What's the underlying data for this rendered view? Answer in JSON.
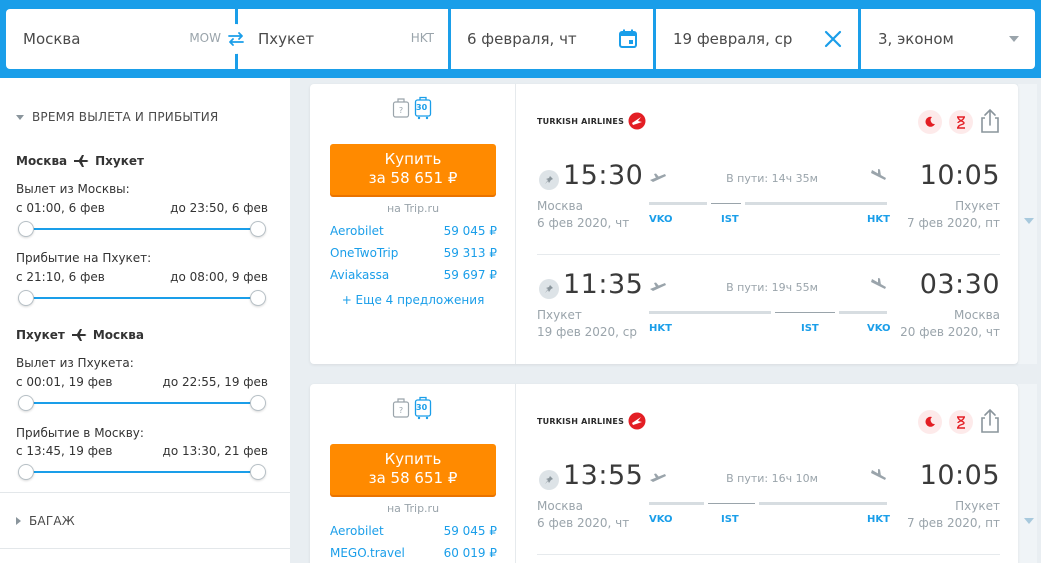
{
  "search": {
    "origin": "Москва",
    "origin_code": "MOW",
    "destination": "Пхукет",
    "destination_code": "HKT",
    "depart_date": "6 февраля, чт",
    "return_date": "19 февраля, ср",
    "passengers": "3, эконом"
  },
  "sidebar": {
    "time_filter_title": "ВРЕМЯ ВЫЛЕТА И ПРИБЫТИЯ",
    "outbound": {
      "route_from": "Москва",
      "route_to": "Пхукет",
      "departure_label": "Вылет из Москвы:",
      "departure_from": "с 01:00, 6 фев",
      "departure_to": "до 23:50, 6 фев",
      "arrival_label": "Прибытие на Пхукет:",
      "arrival_from": "с 21:10, 6 фев",
      "arrival_to": "до 08:00, 9 фев"
    },
    "inbound": {
      "route_from": "Пхукет",
      "route_to": "Москва",
      "departure_label": "Вылет из Пхукета:",
      "departure_from": "с 00:01, 19 фев",
      "departure_to": "до 22:55, 19 фев",
      "arrival_label": "Прибытие в Москву:",
      "arrival_from": "с 13:45, 19 фев",
      "arrival_to": "до 13:30, 21 фев"
    },
    "baggage_title": "БАГАЖ"
  },
  "tickets": [
    {
      "baggage_weight": "30",
      "buy_label": "Купить",
      "price": "за 58 651 ₽",
      "seller": "на Trip.ru",
      "offers": [
        {
          "agency": "Aerobilet",
          "price": "59 045 ₽"
        },
        {
          "agency": "OneTwoTrip",
          "price": "59 313 ₽"
        },
        {
          "agency": "Aviakassa",
          "price": "59 697 ₽"
        }
      ],
      "more_offers": "+ Еще 4 предложения",
      "airline": "TURKISH AIRLINES",
      "segments": [
        {
          "dep_time": "15:30",
          "arr_time": "10:05",
          "dep_city": "Москва",
          "arr_city": "Пхукет",
          "dep_date": "6 фев 2020, чт",
          "arr_date": "7 фев 2020, пт",
          "duration": "В пути: 14ч 35м",
          "from_code": "VKO",
          "via_code": "IST",
          "to_code": "HKT"
        },
        {
          "dep_time": "11:35",
          "arr_time": "03:30",
          "dep_city": "Пхукет",
          "arr_city": "Москва",
          "dep_date": "19 фев 2020, ср",
          "arr_date": "20 фев 2020, чт",
          "duration": "В пути: 19ч 55м",
          "from_code": "HKT",
          "via_code": "IST",
          "to_code": "VKO"
        }
      ]
    },
    {
      "baggage_weight": "30",
      "buy_label": "Купить",
      "price": "за 58 651 ₽",
      "seller": "на Trip.ru",
      "offers": [
        {
          "agency": "Aerobilet",
          "price": "59 045 ₽"
        },
        {
          "agency": "MEGO.travel",
          "price": "60 019 ₽"
        }
      ],
      "airline": "TURKISH AIRLINES",
      "segments": [
        {
          "dep_time": "13:55",
          "arr_time": "10:05",
          "dep_city": "Москва",
          "arr_city": "Пхукет",
          "dep_date": "6 фев 2020, чт",
          "arr_date": "7 фев 2020, пт",
          "duration": "В пути: 16ч 10м",
          "from_code": "VKO",
          "via_code": "IST",
          "to_code": "HKT"
        }
      ]
    }
  ],
  "colors": {
    "brand_blue": "#1a9ee9",
    "buy_orange": "#ff8a00",
    "airline_red": "#e31e24"
  }
}
